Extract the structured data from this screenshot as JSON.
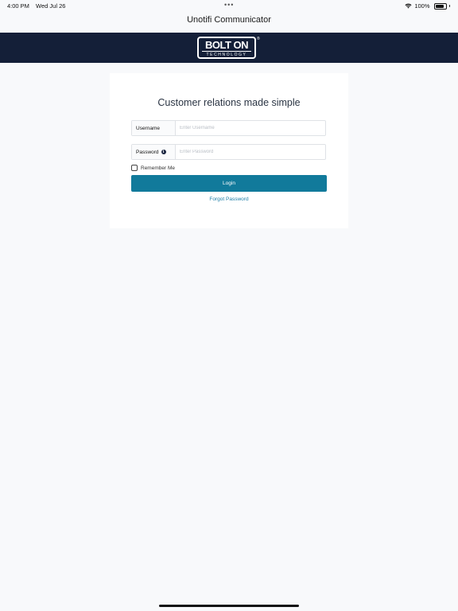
{
  "status_bar": {
    "time": "4:00 PM",
    "date": "Wed Jul 26",
    "battery": "100%",
    "battery_level": 1.0,
    "wifi_icon": "wifi-icon"
  },
  "nav": {
    "title": "Unotifi Communicator"
  },
  "brand": {
    "logo_main": "BOLT ON",
    "logo_sub": "TECHNOLOGY",
    "logo_mark": "®",
    "background": "#141f38"
  },
  "login": {
    "headline": "Customer relations made simple",
    "username_label": "Username",
    "username_placeholder": "Enter Username",
    "password_label": "Password",
    "password_placeholder": "Enter Password",
    "remember_label": "Remember Me",
    "login_label": "Login",
    "forgot_label": "Forgot Password",
    "accent": "#117a9b",
    "link_color": "#1f7fa8"
  }
}
